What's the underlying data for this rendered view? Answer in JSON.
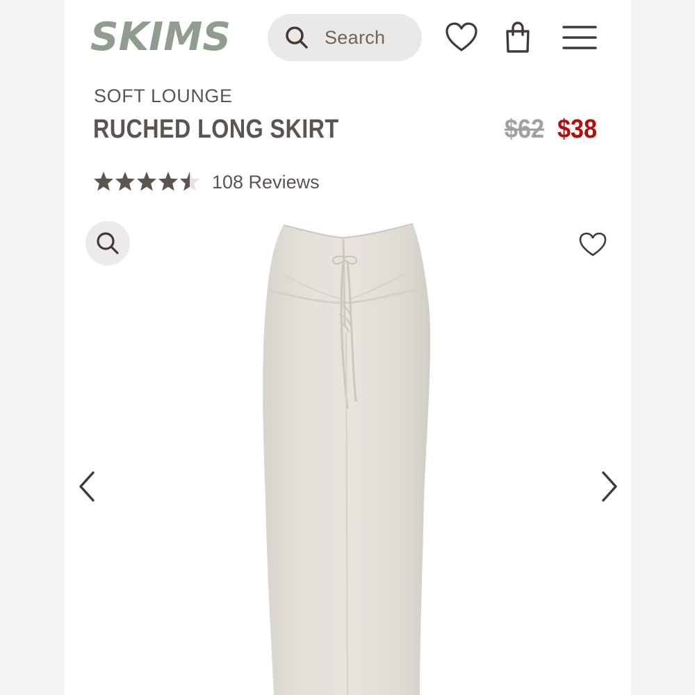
{
  "header": {
    "logo_text": "SKIMS",
    "search_placeholder": "Search",
    "icons": [
      "search-icon",
      "heart-icon",
      "shopping-bag-icon",
      "menu-icon"
    ]
  },
  "product": {
    "category": "SOFT LOUNGE",
    "name": "RUCHED LONG SKIRT",
    "original_price": "$62",
    "sale_price": "$38",
    "rating": 4.5,
    "reviews_label": "108 Reviews"
  },
  "gallery": {
    "icons": [
      "zoom-icon",
      "heart-icon",
      "chevron-left-icon",
      "chevron-right-icon"
    ]
  },
  "colors": {
    "brand_logo": "#8f9c8f",
    "text": "#5b5450",
    "sale": "#b10f0f",
    "strikethrough": "#a3a09e",
    "skirt": "#dfddd6"
  }
}
